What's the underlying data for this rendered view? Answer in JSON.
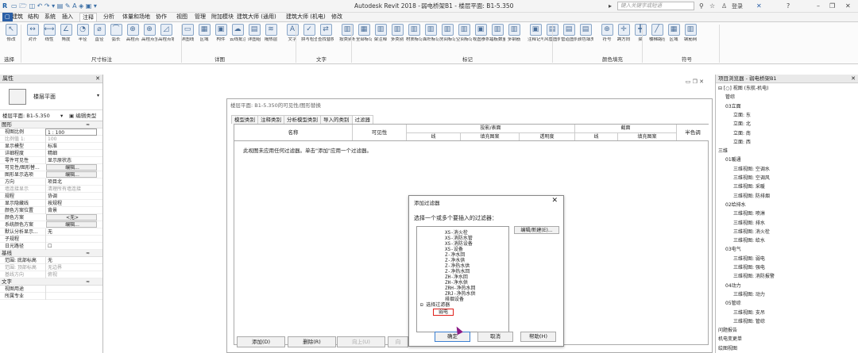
{
  "window": {
    "app_title": "Autodesk Revit 2018 -",
    "doc_title": "弱电桥架B1 - 楼层平面: B1-5.350",
    "search_placeholder": "键入关键字或短语",
    "user": "登录"
  },
  "ribbon": {
    "tabs": [
      "建筑",
      "结构",
      "系统",
      "插入",
      "注释",
      "分析",
      "体量和场地",
      "协作",
      "视图",
      "管理",
      "附加模块",
      "建筑大师 (通用)",
      "建筑大师 (机电)",
      "修改"
    ],
    "active_tab": "注释",
    "buttons": [
      "修改",
      "对齐",
      "线性",
      "角度",
      "半径",
      "直径",
      "弧长",
      "高程点",
      "高程点坐标",
      "高程点坡度",
      "详图线",
      "区域",
      "构件",
      "云线批注",
      "详图组",
      "隔热层",
      "文字",
      "拼写检查",
      "查找替换",
      "按类别标记",
      "全部标记",
      "梁注释",
      "多类别",
      "材质标记",
      "面积标记",
      "房间标记",
      "空间标记",
      "视图参照",
      "踏板数量",
      "多钢筋",
      "注释记号",
      "风管图例",
      "管道图例",
      "颜色填充图例",
      "符号",
      "跨方向",
      "梁",
      "楼梯路径",
      "区域",
      "钢筋网"
    ],
    "groups": [
      "选择",
      "尺寸标注",
      "详图",
      "文字",
      "标记",
      "颜色填充",
      "符号"
    ]
  },
  "properties": {
    "header": "属性",
    "type_name": "楼层平面",
    "view_selector": "楼层平面: B1-5.350",
    "edit_type": "编辑类型",
    "section_graphics": "图形",
    "rows": [
      {
        "k": "视图比例",
        "v": "1 : 100",
        "style": "input"
      },
      {
        "k": "比例值 1:",
        "v": "100",
        "style": "grey"
      },
      {
        "k": "显示模型",
        "v": "标准",
        "style": ""
      },
      {
        "k": "详细程度",
        "v": "精细",
        "style": ""
      },
      {
        "k": "零件可见性",
        "v": "显示原状态",
        "style": ""
      },
      {
        "k": "可见性/图形替...",
        "v": "编辑...",
        "style": "btn"
      },
      {
        "k": "图形显示选项",
        "v": "编辑...",
        "style": "btn"
      },
      {
        "k": "方向",
        "v": "项目北",
        "style": ""
      },
      {
        "k": "墙连接显示",
        "v": "清理所有墙连接",
        "style": "grey"
      },
      {
        "k": "规程",
        "v": "协调",
        "style": ""
      },
      {
        "k": "显示隐藏线",
        "v": "按规程",
        "style": ""
      },
      {
        "k": "颜色方案位置",
        "v": "背景",
        "style": ""
      },
      {
        "k": "颜色方案",
        "v": "<无>",
        "style": "btn"
      },
      {
        "k": "系统颜色方案",
        "v": "编辑...",
        "style": "btn"
      },
      {
        "k": "默认分析显示...",
        "v": "无",
        "style": ""
      },
      {
        "k": "子规程",
        "v": "",
        "style": ""
      },
      {
        "k": "日光路径",
        "v": "☐",
        "style": ""
      }
    ],
    "section_base": "基线",
    "base_rows": [
      {
        "k": "范围: 底部标高",
        "v": "无",
        "style": ""
      },
      {
        "k": "范围: 顶部标高",
        "v": "无边界",
        "style": "grey"
      },
      {
        "k": "基线方向",
        "v": "俯视",
        "style": "grey"
      }
    ],
    "section_text": "文字",
    "text_rows": [
      {
        "k": "视图用途",
        "v": "",
        "style": ""
      },
      {
        "k": "所属专业",
        "v": "",
        "style": ""
      }
    ]
  },
  "vg_dialog": {
    "title": "楼层平面: B1-5.350的可见性/图形替换",
    "tabs": [
      "模型类别",
      "注释类别",
      "分析模型类别",
      "导入的类别",
      "过滤器"
    ],
    "active_tab": "过滤器",
    "col_name": "名称",
    "col_visibility": "可见性",
    "col_projection": "投影/表面",
    "col_cut": "截面",
    "col_halftone": "半色调",
    "sub_line": "线",
    "sub_pattern": "填充图案",
    "sub_transparency": "透明度",
    "empty_msg": "此视图未应用任何过滤器。单击\"添加\"应用一个过滤器。",
    "btn_add": "添加(D)",
    "btn_delete": "删除(R)",
    "btn_up": "向上(U)",
    "btn_down": "向"
  },
  "add_filter": {
    "title": "添加过滤器",
    "prompt": "选择一个或多个要插入的过滤器：",
    "items": [
      "XS-消火栓",
      "XS-消防水管",
      "XS-消防设备",
      "XS-设备",
      "Z-净水回",
      "Z-净水供",
      "Z-净热水供",
      "Z-净热水回",
      "ZH-净水回",
      "ZH-净水供",
      "ZRH-净热水回",
      "ZRJ-净热水供",
      "排烟设备"
    ],
    "group_label": "选择过滤器",
    "selected_item": "弱电",
    "edit_btn": "编辑/新建(E)...",
    "ok": "确定",
    "cancel": "取消",
    "help": "帮助(H)"
  },
  "browser": {
    "header": "项目浏览器 - 弱电桥架B1",
    "nodes": [
      {
        "t": "⊟ [○] 视图 (东航-机电)",
        "x": 3
      },
      {
        "t": "管综",
        "x": 12
      },
      {
        "t": "03立面",
        "x": 12
      },
      {
        "t": "立面: 东",
        "x": 22
      },
      {
        "t": "立面: 北",
        "x": 22
      },
      {
        "t": "立面: 南",
        "x": 22
      },
      {
        "t": "立面: 西",
        "x": 22
      },
      {
        "t": "三维",
        "x": 3
      },
      {
        "t": "01暖通",
        "x": 12
      },
      {
        "t": "三维视图: 空调水",
        "x": 22
      },
      {
        "t": "三维视图: 空调风",
        "x": 22
      },
      {
        "t": "三维视图: 采暖",
        "x": 22
      },
      {
        "t": "三维视图: 防排烟",
        "x": 22
      },
      {
        "t": "02给排水",
        "x": 12
      },
      {
        "t": "三维视图: 喷淋",
        "x": 22
      },
      {
        "t": "三维视图: 排水",
        "x": 22
      },
      {
        "t": "三维视图: 消火栓",
        "x": 22
      },
      {
        "t": "三维视图: 给水",
        "x": 22
      },
      {
        "t": "03电气",
        "x": 12
      },
      {
        "t": "三维视图: 弱电",
        "x": 22
      },
      {
        "t": "三维视图: 强电",
        "x": 22
      },
      {
        "t": "三维视图: 消防报警",
        "x": 22
      },
      {
        "t": "04动力",
        "x": 12
      },
      {
        "t": "三维视图: 动力",
        "x": 22
      },
      {
        "t": "05管综",
        "x": 12
      },
      {
        "t": "三维视图: 支吊",
        "x": 22
      },
      {
        "t": "三维视图: 管综",
        "x": 22
      },
      {
        "t": "问题报告",
        "x": 3
      },
      {
        "t": "机电变更单",
        "x": 3
      },
      {
        "t": "绘图视图",
        "x": 3
      }
    ]
  }
}
